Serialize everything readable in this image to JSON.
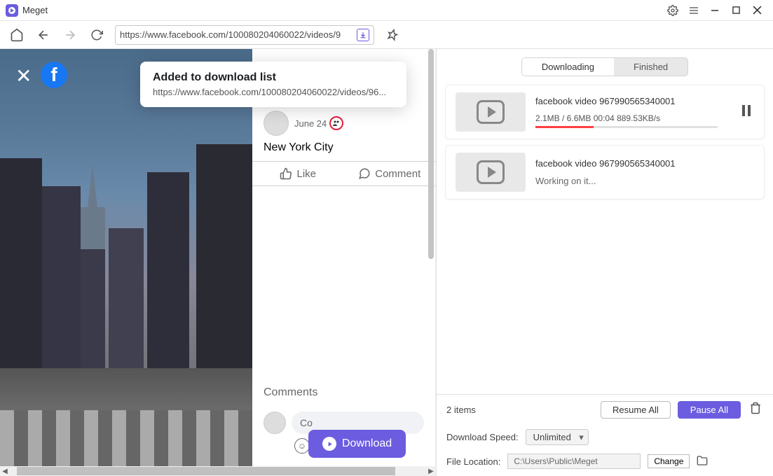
{
  "app": {
    "title": "Meget"
  },
  "browser": {
    "url": "https://www.facebook.com/100080204060022/videos/9"
  },
  "toast": {
    "title": "Added to download list",
    "url": "https://www.facebook.com/100080204060022/videos/96..."
  },
  "post": {
    "date": "June 24",
    "title": "New York City",
    "like_label": "Like",
    "comment_label": "Comment",
    "comments_heading": "Comments",
    "comment_placeholder": "Co"
  },
  "download_button": "Download",
  "tabs": {
    "downloading": "Downloading",
    "finished": "Finished"
  },
  "downloads": [
    {
      "name": "facebook video 967990565340001",
      "stats": "2.1MB / 6.6MB 00:04  889.53KB/s",
      "progress_pct": 32
    },
    {
      "name": "facebook video 967990565340001",
      "status": "Working on it..."
    }
  ],
  "footer": {
    "items": "2 items",
    "resume_all": "Resume All",
    "pause_all": "Pause All",
    "speed_label": "Download Speed:",
    "speed_value": "Unlimited",
    "location_label": "File Location:",
    "location_value": "C:\\Users\\Public\\Meget",
    "change": "Change"
  }
}
